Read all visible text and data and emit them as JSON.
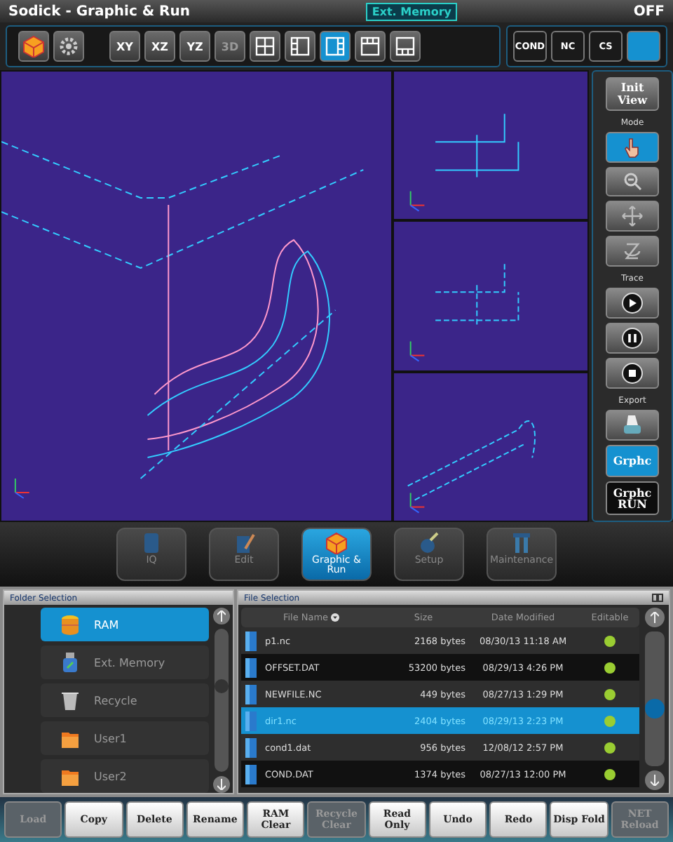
{
  "title_bar": {
    "title": "Sodick - Graphic & Run",
    "center_label": "Ext. Memory",
    "status": "OFF"
  },
  "toolbar": {
    "view_buttons": [
      {
        "label": "XY",
        "selected": false,
        "disabled": false
      },
      {
        "label": "XZ",
        "selected": false,
        "disabled": false
      },
      {
        "label": "YZ",
        "selected": false,
        "disabled": false
      },
      {
        "label": "3D",
        "selected": false,
        "disabled": true
      }
    ],
    "layout_buttons": [
      {
        "kind": "quad",
        "selected": false
      },
      {
        "kind": "left",
        "selected": false
      },
      {
        "kind": "right",
        "selected": true
      },
      {
        "kind": "top",
        "selected": false
      },
      {
        "kind": "bottom",
        "selected": false
      }
    ],
    "mode_buttons": [
      {
        "label": "COND",
        "selected": false
      },
      {
        "label": "NC",
        "selected": false
      },
      {
        "label": "CS",
        "selected": false
      }
    ]
  },
  "side_panel": {
    "init_view": "Init View",
    "sections": [
      {
        "heading": "Mode",
        "buttons": [
          {
            "kind": "pointer",
            "selected": true
          },
          {
            "kind": "zoom",
            "selected": false
          },
          {
            "kind": "pan",
            "selected": false
          },
          {
            "kind": "rotate",
            "selected": false
          }
        ]
      },
      {
        "heading": "Trace",
        "buttons": [
          {
            "kind": "play",
            "selected": false
          },
          {
            "kind": "pause",
            "selected": false
          },
          {
            "kind": "stop",
            "selected": false
          }
        ]
      },
      {
        "heading": "Export",
        "buttons": [
          {
            "kind": "print",
            "selected": false
          }
        ]
      }
    ],
    "export_buttons": [
      {
        "label": "Grphc",
        "selected": true
      },
      {
        "label": "Grphc RUN",
        "selected": false
      }
    ]
  },
  "nav": [
    {
      "label": "IQ",
      "kind": "iq",
      "selected": false
    },
    {
      "label": "Edit",
      "kind": "edit",
      "selected": false
    },
    {
      "label": "Graphic & Run",
      "kind": "graphic",
      "selected": true
    },
    {
      "label": "Setup",
      "kind": "setup",
      "selected": false
    },
    {
      "label": "Maintenance",
      "kind": "maintenance",
      "selected": false
    }
  ],
  "folders": {
    "title": "Folder Selection",
    "items": [
      {
        "label": "RAM",
        "kind": "ram",
        "selected": true
      },
      {
        "label": "Ext. Memory",
        "kind": "usb",
        "selected": false
      },
      {
        "label": "Recycle",
        "kind": "recycle",
        "selected": false
      },
      {
        "label": "User1",
        "kind": "folder",
        "selected": false
      },
      {
        "label": "User2",
        "kind": "folder",
        "selected": false
      }
    ]
  },
  "files": {
    "title": "File Selection",
    "columns": [
      "File Name",
      "Size",
      "Date Modified",
      "Editable"
    ],
    "rows": [
      {
        "name": "p1.nc",
        "size": "2168 bytes",
        "date": "08/30/13 11:18 AM",
        "editable": true,
        "selected": false
      },
      {
        "name": "OFFSET.DAT",
        "size": "53200 bytes",
        "date": "08/29/13 4:26 PM",
        "editable": true,
        "selected": false
      },
      {
        "name": "NEWFILE.NC",
        "size": "449 bytes",
        "date": "08/27/13 1:29 PM",
        "editable": true,
        "selected": false
      },
      {
        "name": "dir1.nc",
        "size": "2404 bytes",
        "date": "08/29/13 2:23 PM",
        "editable": true,
        "selected": true
      },
      {
        "name": "cond1.dat",
        "size": "956 bytes",
        "date": "12/08/12 2:57 PM",
        "editable": true,
        "selected": false
      },
      {
        "name": "COND.DAT",
        "size": "1374 bytes",
        "date": "08/27/13 12:00 PM",
        "editable": true,
        "selected": false
      }
    ]
  },
  "actions": [
    {
      "label": "Load",
      "disabled": true
    },
    {
      "label": "Copy",
      "disabled": false
    },
    {
      "label": "Delete",
      "disabled": false
    },
    {
      "label": "Rename",
      "disabled": false
    },
    {
      "label": "RAM Clear",
      "disabled": false
    },
    {
      "label": "Recycle Clear",
      "disabled": true
    },
    {
      "label": "Read Only",
      "disabled": false
    },
    {
      "label": "Undo",
      "disabled": false
    },
    {
      "label": "Redo",
      "disabled": false
    },
    {
      "label": "Disp Fold",
      "disabled": false
    },
    {
      "label": "NET Reload",
      "disabled": true
    }
  ]
}
